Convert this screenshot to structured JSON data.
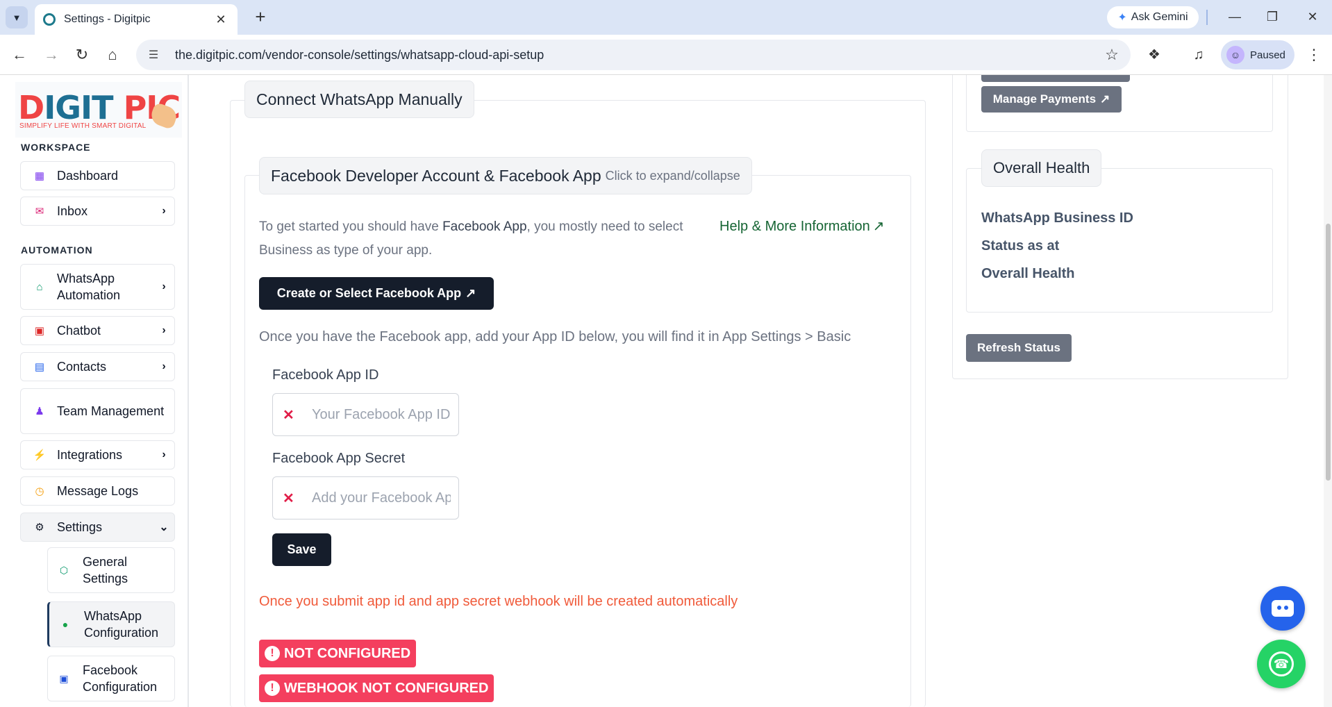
{
  "browser": {
    "tab_title": "Settings - Digitpic",
    "url": "the.digitpic.com/vendor-console/settings/whatsapp-cloud-api-setup",
    "gemini_label": "Ask Gemini",
    "profile_status": "Paused"
  },
  "logo": {
    "main_left": "D",
    "main_mid": "IGIT ",
    "main_right": "PIC",
    "tagline": "SIMPLIFY LIFE WITH SMART DIGITAL"
  },
  "sidebar": {
    "workspace_title": "WORKSPACE",
    "automation_title": "AUTOMATION",
    "items": [
      {
        "label": "Dashboard"
      },
      {
        "label": "Inbox"
      },
      {
        "label": "WhatsApp Automation"
      },
      {
        "label": "Chatbot"
      },
      {
        "label": "Contacts"
      },
      {
        "label": "Team Management"
      },
      {
        "label": "Integrations"
      },
      {
        "label": "Message Logs"
      },
      {
        "label": "Settings"
      }
    ],
    "sub_items": [
      {
        "label": "General Settings"
      },
      {
        "label": "WhatsApp Configuration"
      },
      {
        "label": "Facebook Configuration"
      }
    ]
  },
  "main": {
    "section_title": "Connect WhatsApp Manually",
    "fieldset_title": "Facebook Developer Account & Facebook App",
    "fieldset_hint": "Click to expand/collapse",
    "intro_part1": "To get started you should have ",
    "intro_bold": "Facebook App",
    "intro_part2": ", you mostly need to select Business as type of your app.",
    "help_link": "Help & More Information",
    "create_button": "Create or Select Facebook App",
    "helper_text": "Once you have the Facebook app, add your App ID below, you will find it in App Settings > Basic",
    "app_id_label": "Facebook App ID",
    "app_id_placeholder": "Your Facebook App ID",
    "app_secret_label": "Facebook App Secret",
    "app_secret_placeholder": "Add your Facebook App Secret",
    "save_button": "Save",
    "warning_text": "Once you submit app id and app secret webhook will be created automatically",
    "badge_not_configured": "NOT CONFIGURED",
    "badge_webhook": "WEBHOOK NOT CONFIGURED"
  },
  "right": {
    "manage_payments": "Manage Payments",
    "health_title": "Overall Health",
    "health_lines": [
      "WhatsApp Business ID",
      "Status as at",
      "Overall Health"
    ],
    "refresh_button": "Refresh Status"
  },
  "colors": {
    "accent_dark": "#151d2b",
    "badge_red": "#f43f5e",
    "warning_orange": "#f05a3a",
    "help_green": "#166534",
    "whatsapp_green": "#25d366",
    "bot_blue": "#2563eb"
  }
}
